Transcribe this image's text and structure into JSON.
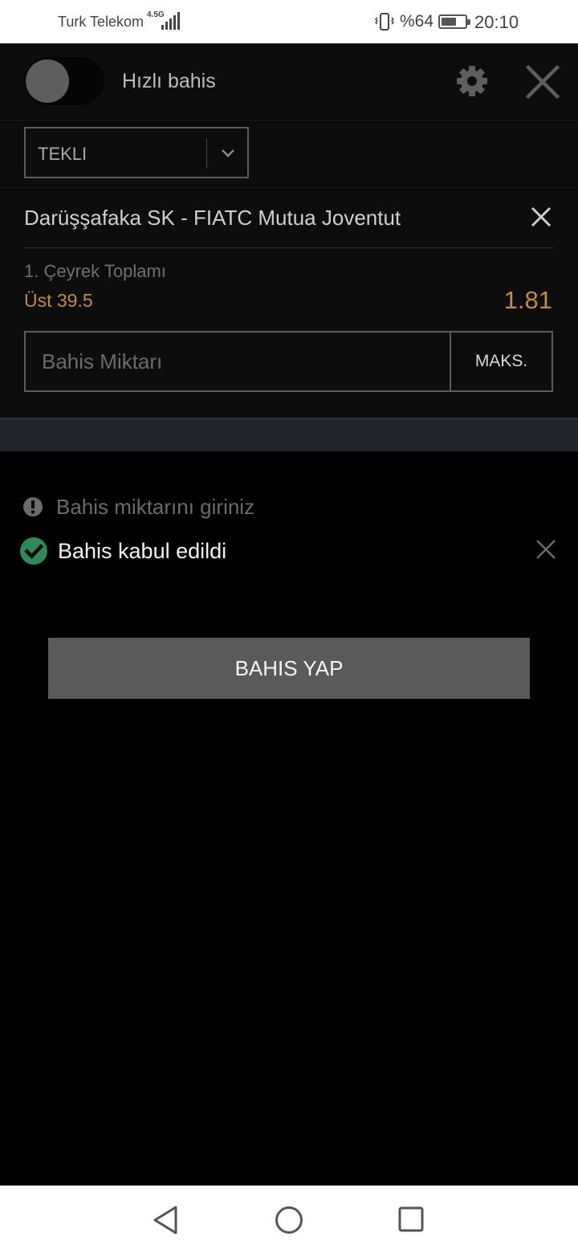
{
  "status_bar": {
    "carrier": "Turk Telekom",
    "network": "4.5G",
    "battery_percent": "%64",
    "battery_level": 0.64,
    "time": "20:10"
  },
  "header": {
    "quick_bet_label": "Hızlı bahis",
    "quick_bet_enabled": false,
    "icons": [
      "gear-icon",
      "close-icon"
    ]
  },
  "bet_type": {
    "selected": "TEKLI"
  },
  "bet": {
    "match": "Darüşşafaka SK - FIATC Mutua Joventut",
    "market": "1. Çeyrek Toplamı",
    "selection": "Üst 39.5",
    "odds": "1.81"
  },
  "stake": {
    "placeholder": "Bahis Miktarı",
    "value": "",
    "max_label": "MAKS."
  },
  "messages": {
    "warning": "Bahis miktarını giriniz",
    "success": "Bahis kabul edildi"
  },
  "actions": {
    "place_bet_label": "BAHIS YAP"
  },
  "colors": {
    "accent": "#c68a3e",
    "success": "#2e8b57",
    "background": "#000000"
  }
}
